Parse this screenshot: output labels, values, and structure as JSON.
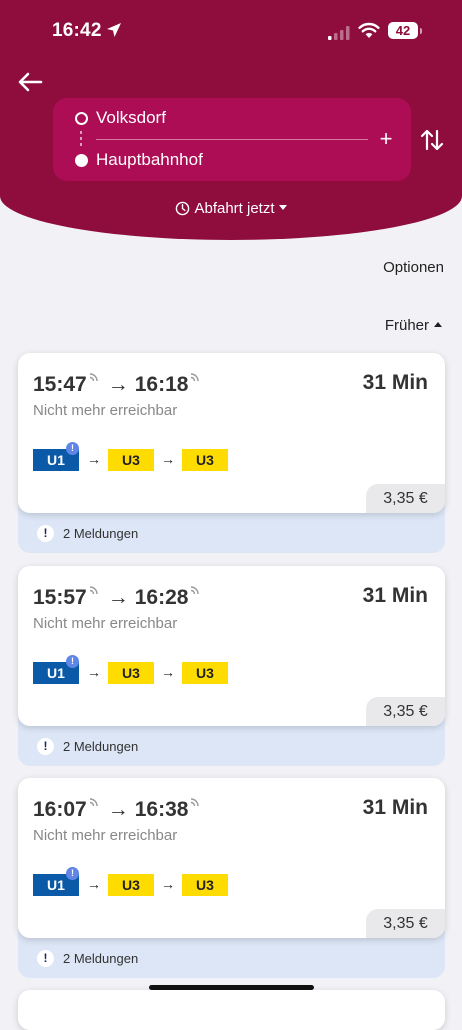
{
  "status_bar": {
    "time": "16:42",
    "battery": "42"
  },
  "route": {
    "from": "Volksdorf",
    "to": "Hauptbahnhof",
    "add_symbol": "+"
  },
  "departure_filter": "Abfahrt jetzt",
  "options_label": "Optionen",
  "earlier_label": "Früher",
  "trips": [
    {
      "depart": "15:47",
      "arrow": "→",
      "arrive": "16:18",
      "duration": "31 Min",
      "status": "Nicht mehr erreichbar",
      "lines": [
        "U1",
        "U3",
        "U3"
      ],
      "line_arrow": "→",
      "alert_mark": "!",
      "price": "3,35 €",
      "notice_mark": "!",
      "notice": "2 Meldungen"
    },
    {
      "depart": "15:57",
      "arrow": "→",
      "arrive": "16:28",
      "duration": "31 Min",
      "status": "Nicht mehr erreichbar",
      "lines": [
        "U1",
        "U3",
        "U3"
      ],
      "line_arrow": "→",
      "alert_mark": "!",
      "price": "3,35 €",
      "notice_mark": "!",
      "notice": "2 Meldungen"
    },
    {
      "depart": "16:07",
      "arrow": "→",
      "arrive": "16:38",
      "duration": "31 Min",
      "status": "Nicht mehr erreichbar",
      "lines": [
        "U1",
        "U3",
        "U3"
      ],
      "line_arrow": "→",
      "alert_mark": "!",
      "price": "3,35 €",
      "notice_mark": "!",
      "notice": "2 Meldungen"
    }
  ],
  "colors": {
    "header": "#8f0d3c",
    "route_box": "#ad0d55",
    "u1": "#0b5aa8",
    "u3": "#ffdc00",
    "notice_bg": "#dce6f6"
  },
  "icons": [
    "location-arrow-icon",
    "signal-icon",
    "wifi-icon",
    "battery-icon",
    "back-arrow-icon",
    "swap-icon",
    "clock-icon",
    "realtime-icon"
  ]
}
